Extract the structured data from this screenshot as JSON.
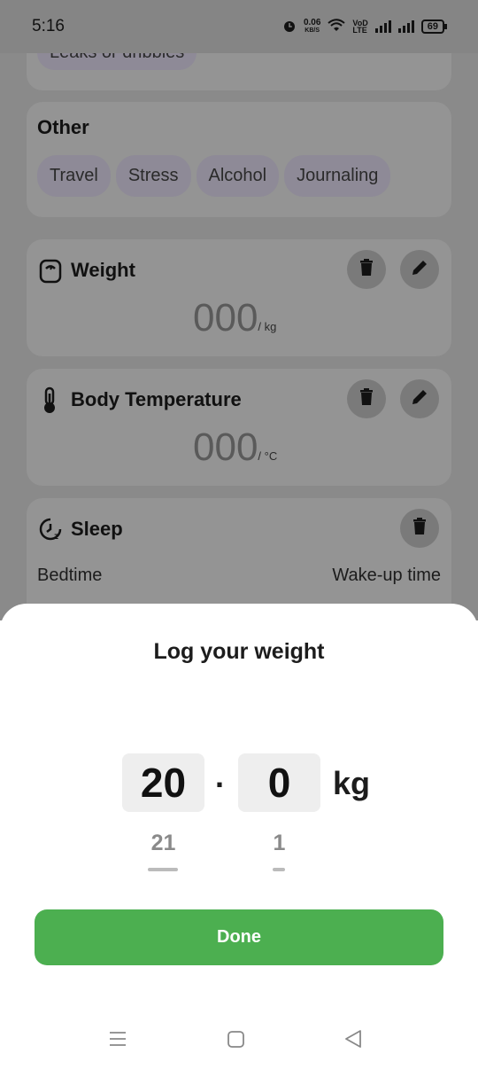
{
  "status_bar": {
    "time": "5:16",
    "speed_value": "0.06",
    "speed_unit": "KB/S",
    "network_tag": "VoD\nLTE",
    "battery": "69"
  },
  "background": {
    "top_chip": "Leaks or dribbles",
    "other_section": {
      "title": "Other",
      "chips": [
        "Travel",
        "Stress",
        "Alcohol",
        "Journaling"
      ]
    },
    "weight_card": {
      "title": "Weight",
      "value": "000",
      "unit": "/ kg"
    },
    "temperature_card": {
      "title": "Body Temperature",
      "value": "000",
      "unit": "/ °C"
    },
    "sleep_card": {
      "title": "Sleep",
      "bedtime_label": "Bedtime",
      "wakeup_label": "Wake-up time"
    }
  },
  "sheet": {
    "title": "Log your weight",
    "integer_value": "20",
    "decimal_separator": ".",
    "decimal_value": "0",
    "unit": "kg",
    "next_integer": "21",
    "next_decimal": "1",
    "done_label": "Done"
  },
  "colors": {
    "accent": "#4caf50"
  }
}
